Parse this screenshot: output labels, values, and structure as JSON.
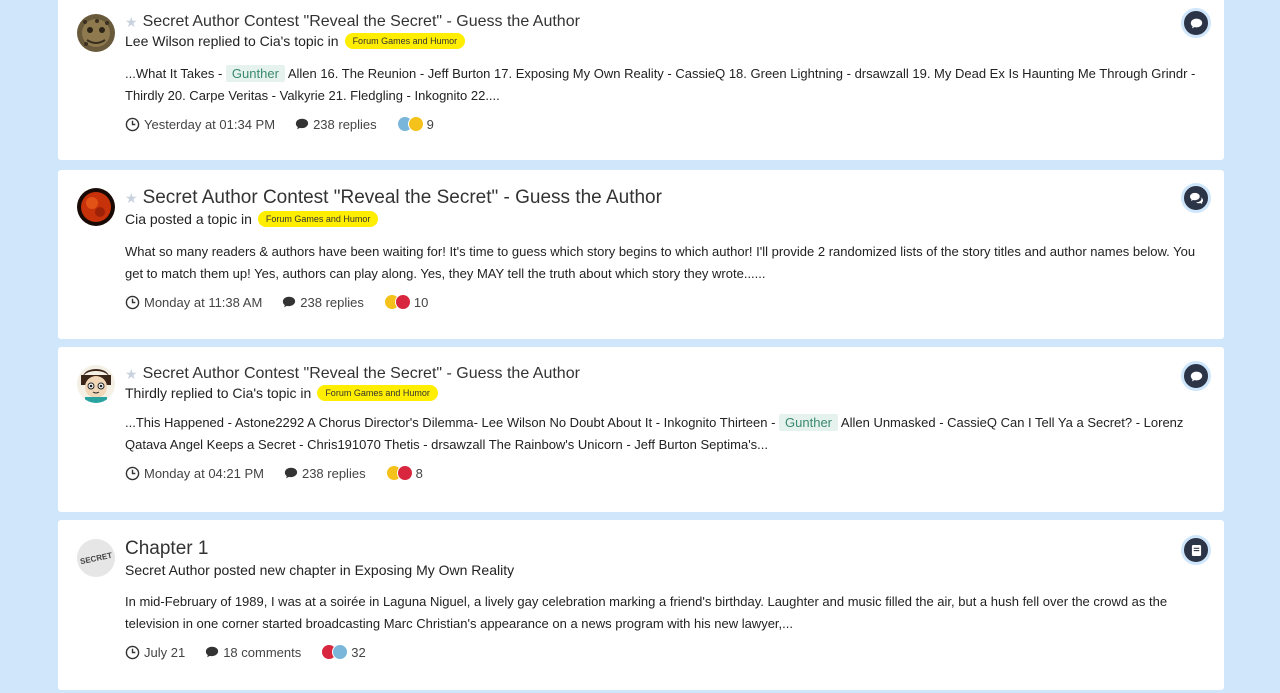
{
  "items": [
    {
      "title": "Secret Author Contest \"Reveal the Secret\" - Guess the Author",
      "action": "Lee Wilson replied to Cia's topic in",
      "tag": "Forum Games and Humor",
      "snippet_pre": "...What It Takes -",
      "snippet_hl": "Gunther",
      "snippet_post": "Allen 16. The Reunion - Jeff Burton 17. Exposing My Own Reality - CassieQ 18. Green Lightning - drsawzall 19. My Dead Ex Is Haunting Me Through Grindr - Thirdly 20. Carpe Veritas - Valkyrie 21. Fledgling - Inkognito 22....",
      "time": "Yesterday at 01:34 PM",
      "replies": "238 replies",
      "reactions": "9",
      "type_icon": "comment-icon"
    },
    {
      "title": "Secret Author Contest \"Reveal the Secret\" - Guess the Author",
      "action": "Cia posted a topic in",
      "tag": "Forum Games and Humor",
      "snippet": "What so many readers & authors have been waiting for! It's time to guess which story begins to which author! I'll provide 2 randomized lists of the story titles and author names below. You get to match them up! Yes, authors can play along. Yes, they MAY tell the truth about which story they wrote......",
      "time": "Monday at 11:38 AM",
      "replies": "238 replies",
      "reactions": "10",
      "type_icon": "comments-icon"
    },
    {
      "title": "Secret Author Contest \"Reveal the Secret\" - Guess the Author",
      "action": "Thirdly replied to Cia's topic in",
      "tag": "Forum Games and Humor",
      "snippet_pre": "...This Happened - Astone2292 A Chorus Director's Dilemma- Lee Wilson No Doubt About It - Inkognito Thirteen -",
      "snippet_hl": "Gunther",
      "snippet_post": "Allen Unmasked - CassieQ Can I Tell Ya a Secret? - Lorenz Qatava Angel Keeps a Secret - Chris191070 Thetis - drsawzall The Rainbow's Unicorn - Jeff Burton Septima's...",
      "time": "Monday at 04:21 PM",
      "replies": "238 replies",
      "reactions": "8",
      "type_icon": "comment-icon"
    },
    {
      "title": "Chapter 1",
      "action": "Secret Author posted new chapter in Exposing My Own Reality",
      "snippet": "In mid-February of 1989, I was at a soirée in Laguna Niguel, a lively gay celebration marking a friend's birthday. Laughter and music filled the air, but a hush fell over the crowd as the television in one corner started broadcasting Marc Christian's appearance on a news program with his new lawyer,...",
      "time": "July 21",
      "replies": "18 comments",
      "reactions": "32",
      "avatar_text": "SECRET",
      "type_icon": "book-icon"
    }
  ]
}
